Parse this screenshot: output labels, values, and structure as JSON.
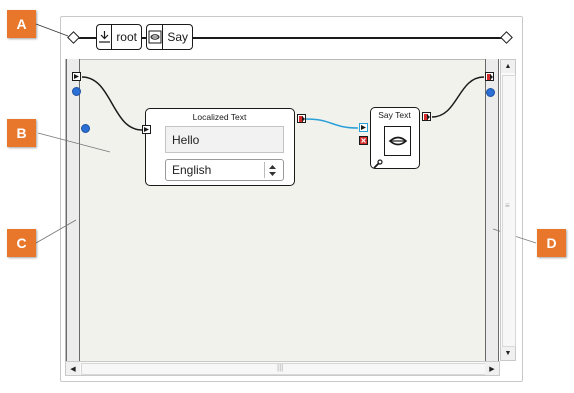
{
  "callouts": {
    "a": "A",
    "b": "B",
    "c": "C",
    "d": "D"
  },
  "breadcrumb": {
    "root_label": "root",
    "say_label": "Say",
    "root_icon": "root-diagram-icon",
    "say_icon": "speech-bubble-icon"
  },
  "localized_text_box": {
    "title": "Localized Text",
    "text_value": "Hello",
    "language_value": "English"
  },
  "say_text_box": {
    "title": "Say Text",
    "icon": "mouth-icon"
  },
  "colors": {
    "callout": "#e8762b",
    "canvas": "#f2f2ed",
    "link": "#2aa0d8",
    "output_port": "#d62b2b",
    "plus": "#2b6fd6"
  },
  "scrollbars": {
    "up_arrow": "▲",
    "down_arrow": "▼",
    "left_arrow": "◀",
    "right_arrow": "▶",
    "v_grip": "≡",
    "h_grip": "|||"
  }
}
